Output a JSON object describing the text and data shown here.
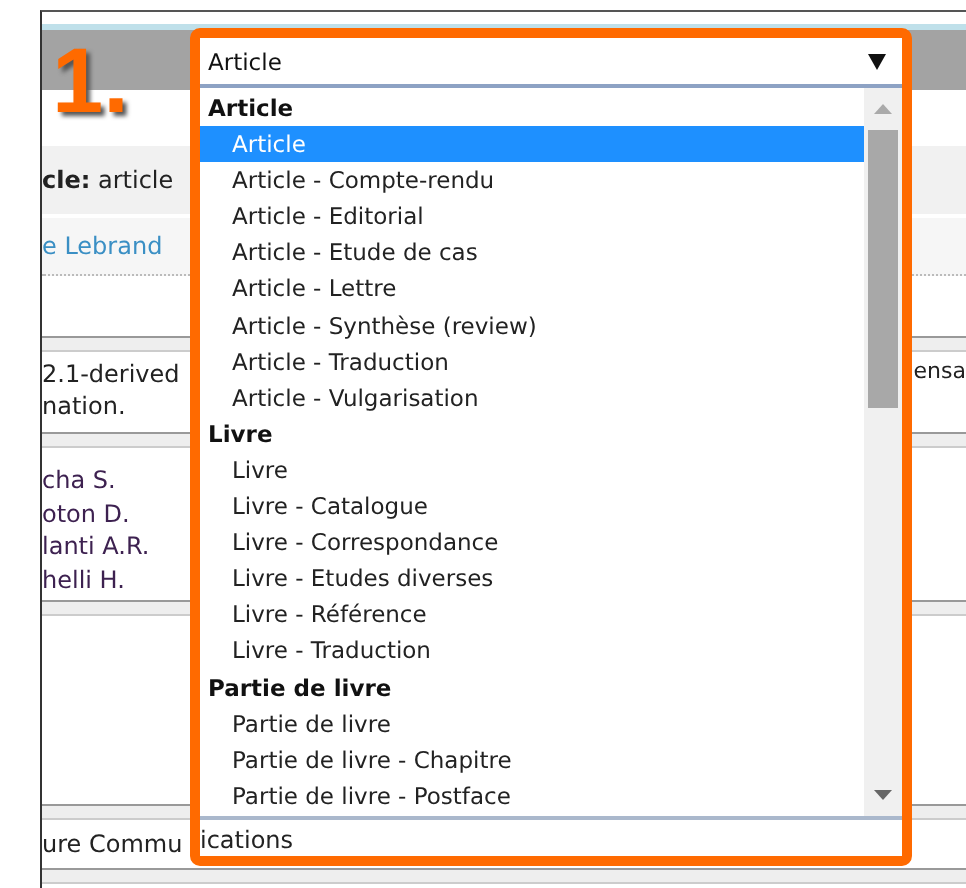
{
  "step_marker": "1.",
  "page": {
    "record_line": "**cle:** article",
    "author_link": "e Lebrand",
    "abstract_lines": [
      "2.1-derived",
      "nation."
    ],
    "abstract_right": "ensa",
    "authors": [
      "cha S.",
      "oton D.",
      "lanti A.R.",
      "helli H."
    ],
    "journal": "ure Commu",
    "journal_rest": "ications"
  },
  "dropdown": {
    "value": "Article",
    "groups": [
      {
        "label": "Article",
        "options": [
          {
            "label": "Article",
            "selected": true
          },
          {
            "label": "Article - Compte-rendu",
            "selected": false
          },
          {
            "label": "Article - Editorial",
            "selected": false
          },
          {
            "label": "Article - Etude de cas",
            "selected": false
          },
          {
            "label": "Article - Lettre",
            "selected": false
          },
          {
            "label": "Article - Synthèse (review)",
            "selected": false
          },
          {
            "label": "Article - Traduction",
            "selected": false
          },
          {
            "label": "Article - Vulgarisation",
            "selected": false
          }
        ]
      },
      {
        "label": "Livre",
        "options": [
          {
            "label": "Livre",
            "selected": false
          },
          {
            "label": "Livre - Catalogue",
            "selected": false
          },
          {
            "label": "Livre - Correspondance",
            "selected": false
          },
          {
            "label": "Livre - Etudes diverses",
            "selected": false
          },
          {
            "label": "Livre - Référence",
            "selected": false
          },
          {
            "label": "Livre - Traduction",
            "selected": false
          }
        ]
      },
      {
        "label": "Partie de livre",
        "options": [
          {
            "label": "Partie de livre",
            "selected": false
          },
          {
            "label": "Partie de livre - Chapitre",
            "selected": false
          },
          {
            "label": "Partie de livre - Postface",
            "selected": false
          }
        ]
      }
    ]
  }
}
